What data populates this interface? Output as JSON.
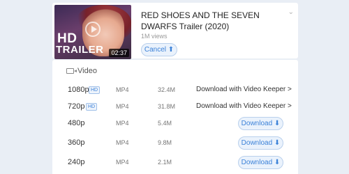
{
  "video": {
    "title": "RED SHOES AND THE SEVEN DWARFS Trailer (2020)",
    "views": "1M views",
    "duration": "02:37",
    "thumb_text_1": "HD",
    "thumb_text_2": "TRAILER",
    "cancel_label": "Cancel ⬆",
    "collapse_icon": "chevron-down-icon"
  },
  "section": {
    "heading": "Video",
    "icon": "video-icon"
  },
  "formats": [
    {
      "res": "1080p",
      "hd": "HD",
      "fmt": "MP4",
      "size": "32.4M",
      "action": "Download with Video Keeper >"
    },
    {
      "res": "720p",
      "hd": "HD",
      "fmt": "MP4",
      "size": "31.8M",
      "action": "Download with Video Keeper >"
    },
    {
      "res": "480p",
      "hd": "",
      "fmt": "MP4",
      "size": "5.4M",
      "action": "Download ⬇"
    },
    {
      "res": "360p",
      "hd": "",
      "fmt": "MP4",
      "size": "9.8M",
      "action": "Download ⬇"
    },
    {
      "res": "240p",
      "hd": "",
      "fmt": "MP4",
      "size": "2.1M",
      "action": "Download ⬇"
    }
  ],
  "colors": {
    "background": "#e9eef5",
    "accent": "#3c82d8",
    "button_bg": "#eaf2fc"
  }
}
